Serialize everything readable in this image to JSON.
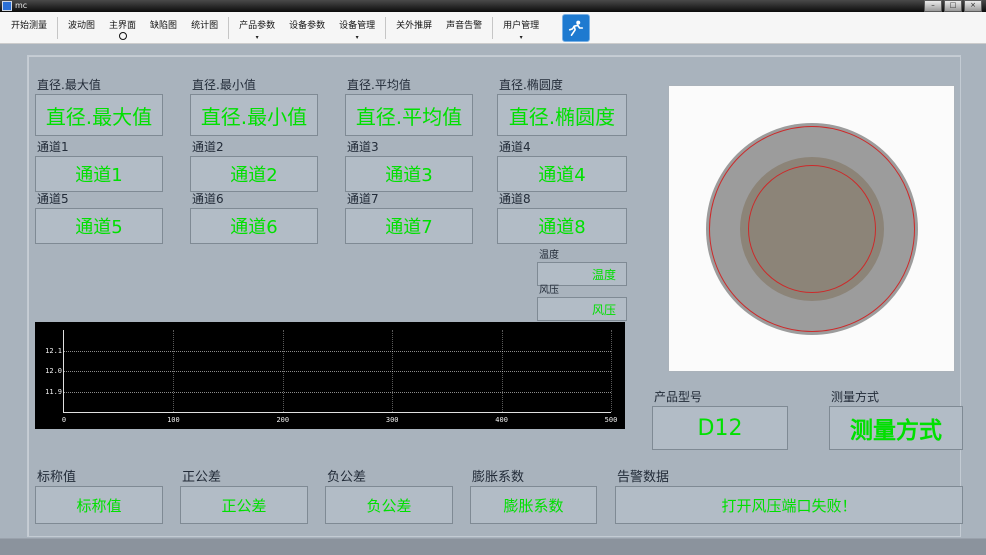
{
  "window": {
    "title": "mc",
    "controls": {
      "minimize": "–",
      "maximize": "□",
      "close": "×"
    }
  },
  "toolbar": {
    "buttons": [
      {
        "label": "开始测量"
      },
      {
        "label": "波动图"
      },
      {
        "label": "主界面"
      },
      {
        "label": "缺陷图"
      },
      {
        "label": "统计图"
      },
      {
        "label": "产品参数"
      },
      {
        "label": "设备参数"
      },
      {
        "label": "设备管理"
      },
      {
        "label": "关外推屏"
      },
      {
        "label": "声音告警"
      },
      {
        "label": "用户管理"
      }
    ]
  },
  "fields": {
    "row1": [
      {
        "label": "直径.最大值",
        "value": "直径.最大值"
      },
      {
        "label": "直径.最小值",
        "value": "直径.最小值"
      },
      {
        "label": "直径.平均值",
        "value": "直径.平均值"
      },
      {
        "label": "直径.椭圆度",
        "value": "直径.椭圆度"
      }
    ],
    "channels": [
      {
        "label": "通道1",
        "value": "通道1"
      },
      {
        "label": "通道2",
        "value": "通道2"
      },
      {
        "label": "通道3",
        "value": "通道3"
      },
      {
        "label": "通道4",
        "value": "通道4"
      },
      {
        "label": "通道5",
        "value": "通道5"
      },
      {
        "label": "通道6",
        "value": "通道6"
      },
      {
        "label": "通道7",
        "value": "通道7"
      },
      {
        "label": "通道8",
        "value": "通道8"
      }
    ],
    "aux": [
      {
        "label": "温度",
        "value": "温度"
      },
      {
        "label": "风压",
        "value": "风压"
      }
    ]
  },
  "chart_data": {
    "type": "line",
    "title": "",
    "x_tick_labels": [
      "0",
      "100",
      "200",
      "300",
      "400",
      "500"
    ],
    "y_tick_labels": [
      "12.1",
      "12.0",
      "11.9"
    ],
    "xlim": [
      0,
      500
    ],
    "ylim": [
      11.9,
      12.1
    ],
    "series": [],
    "grid": "dotted",
    "legend": "none",
    "background": "#000000"
  },
  "product": {
    "model_label": "产品型号",
    "model_value": "D12",
    "method_label": "测量方式",
    "method_value": "测量方式"
  },
  "bottom_fields": [
    {
      "label": "标称值",
      "value": "标称值"
    },
    {
      "label": "正公差",
      "value": "正公差"
    },
    {
      "label": "负公差",
      "value": "负公差"
    },
    {
      "label": "膨胀系数",
      "value": "膨胀系数"
    },
    {
      "label": "告警数据",
      "value": "打开风压端口失败！"
    }
  ],
  "colors": {
    "value_green": "#00e000",
    "background": "#a9b3bd",
    "chart_background": "#000000",
    "ring_red": "#cc2a2a"
  }
}
